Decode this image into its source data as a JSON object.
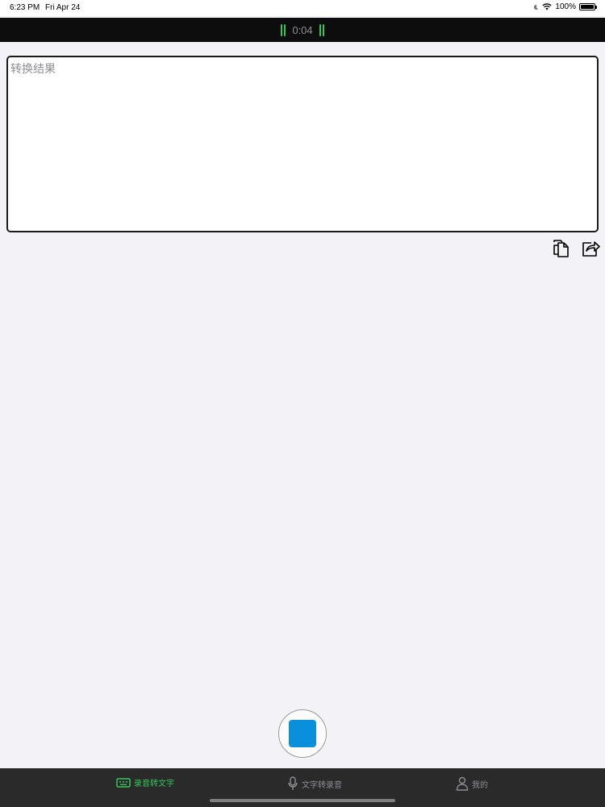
{
  "status_bar": {
    "time": "6:23 PM",
    "date": "Fri Apr 24",
    "battery": "100%",
    "icons": [
      "do-not-disturb-icon",
      "wifi-icon",
      "battery-icon"
    ]
  },
  "recording": {
    "elapsed": "0:04",
    "indicator_color": "#34c759"
  },
  "result": {
    "placeholder": "转换结果",
    "value": ""
  },
  "actions": {
    "copy_icon": "copy-icon",
    "share_icon": "share-icon"
  },
  "record_control": {
    "icon": "stop-icon",
    "color": "#0a8fdb"
  },
  "tabs": [
    {
      "label": "录音转文字",
      "icon": "keyboard-icon",
      "active": true
    },
    {
      "label": "文字转录音",
      "icon": "microphone-icon",
      "active": false
    },
    {
      "label": "我的",
      "icon": "person-icon",
      "active": false
    }
  ],
  "colors": {
    "background": "#f3f2f7",
    "accent": "#34c759",
    "tab_bar": "#2a2a2a"
  }
}
